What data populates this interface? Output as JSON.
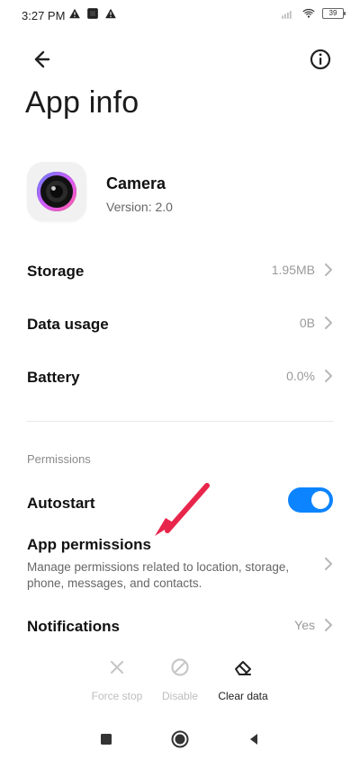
{
  "status": {
    "time": "3:27 PM",
    "battery": "39"
  },
  "page": {
    "title": "App info"
  },
  "app": {
    "name": "Camera",
    "version": "Version: 2.0"
  },
  "rows": {
    "storage": {
      "label": "Storage",
      "value": "1.95MB"
    },
    "data_usage": {
      "label": "Data usage",
      "value": "0B"
    },
    "battery": {
      "label": "Battery",
      "value": "0.0%"
    }
  },
  "permissions": {
    "section_title": "Permissions",
    "autostart": {
      "label": "Autostart",
      "enabled": true
    },
    "app_permissions": {
      "label": "App permissions",
      "description": "Manage permissions related to location, storage, phone, messages, and contacts."
    },
    "notifications": {
      "label": "Notifications",
      "value": "Yes"
    }
  },
  "actions": {
    "force_stop": "Force stop",
    "disable": "Disable",
    "clear_data": "Clear data"
  },
  "colors": {
    "accent": "#0D84FF",
    "arrow": "#E8264C"
  }
}
